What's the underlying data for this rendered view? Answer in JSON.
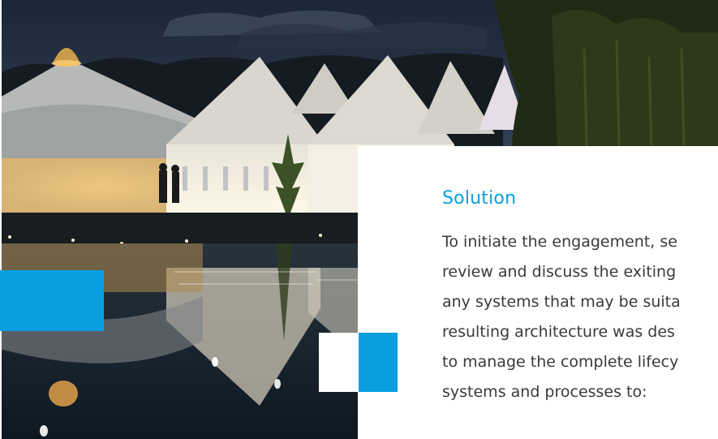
{
  "hero": {
    "alt": "Night event with illuminated marquee tents reflected in a lake"
  },
  "solution": {
    "heading": "Solution",
    "lines": [
      "To initiate the engagement, se",
      "review and discuss the exiting",
      "any systems that may be suita",
      "resulting architecture was des",
      "to manage the complete lifecy",
      "systems and processes to:"
    ]
  },
  "colors": {
    "accent": "#0a9ee0",
    "text": "#3a3a3a",
    "background": "#ffffff"
  }
}
